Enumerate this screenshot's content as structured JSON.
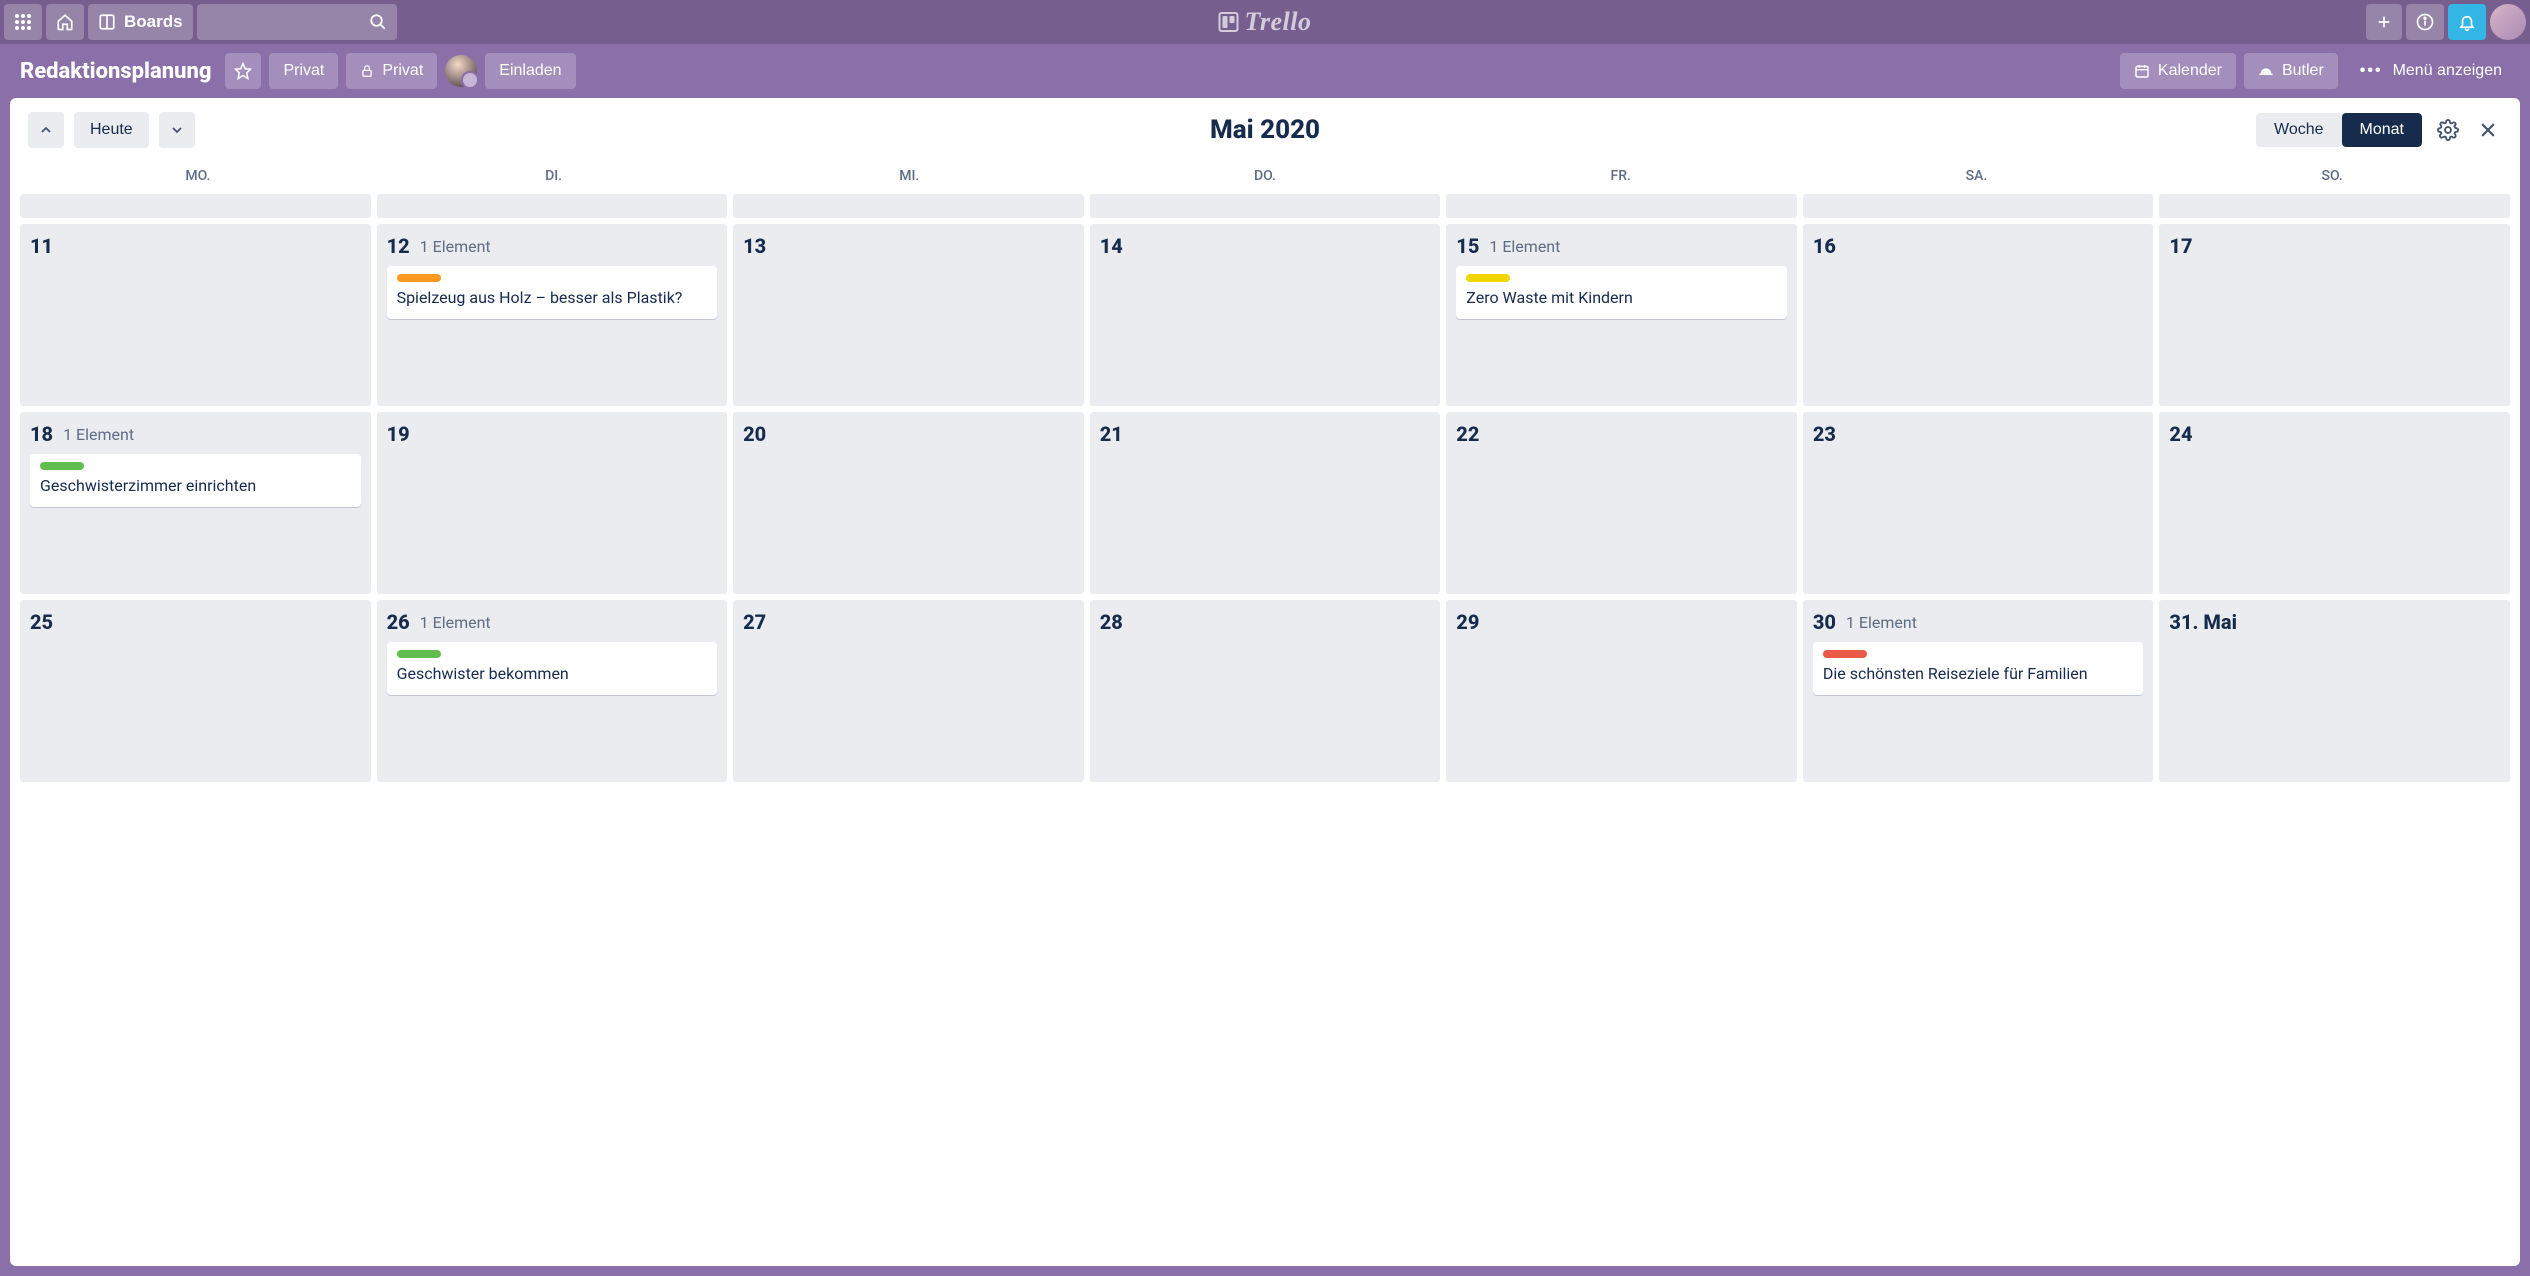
{
  "header": {
    "boards_label": "Boards",
    "logo_text": "Trello"
  },
  "board": {
    "title": "Redaktionsplanung",
    "privacy1": "Privat",
    "privacy2": "Privat",
    "invite_label": "Einladen",
    "calendar_label": "Kalender",
    "butler_label": "Butler",
    "menu_label": "Menü anzeigen"
  },
  "calendar": {
    "title": "Mai 2020",
    "today_label": "Heute",
    "week_label": "Woche",
    "month_label": "Monat",
    "active_view": "month",
    "dow": [
      "MO.",
      "DI.",
      "MI.",
      "DO.",
      "FR.",
      "SA.",
      "SO."
    ],
    "element_word_single": "Element",
    "cells": [
      {
        "day": "",
        "short": true
      },
      {
        "day": "",
        "short": true
      },
      {
        "day": "",
        "short": true
      },
      {
        "day": "",
        "short": true
      },
      {
        "day": "",
        "short": true
      },
      {
        "day": "",
        "short": true
      },
      {
        "day": "",
        "short": true
      },
      {
        "day": "11"
      },
      {
        "day": "12",
        "count": 1,
        "cards": [
          {
            "color": "orange",
            "title": "Spielzeug aus Holz – besser als Plastik?"
          }
        ]
      },
      {
        "day": "13"
      },
      {
        "day": "14"
      },
      {
        "day": "15",
        "count": 1,
        "cards": [
          {
            "color": "yellow",
            "title": "Zero Waste mit Kindern"
          }
        ]
      },
      {
        "day": "16"
      },
      {
        "day": "17"
      },
      {
        "day": "18",
        "count": 1,
        "cards": [
          {
            "color": "green",
            "title": "Geschwisterzimmer einrichten"
          }
        ]
      },
      {
        "day": "19"
      },
      {
        "day": "20"
      },
      {
        "day": "21"
      },
      {
        "day": "22"
      },
      {
        "day": "23"
      },
      {
        "day": "24"
      },
      {
        "day": "25"
      },
      {
        "day": "26",
        "count": 1,
        "cards": [
          {
            "color": "green",
            "title": "Geschwister bekommen"
          }
        ]
      },
      {
        "day": "27"
      },
      {
        "day": "28"
      },
      {
        "day": "29"
      },
      {
        "day": "30",
        "count": 1,
        "cards": [
          {
            "color": "red",
            "title": "Die schönsten Reiseziele für Familien"
          }
        ]
      },
      {
        "day": "31. Mai"
      }
    ]
  }
}
